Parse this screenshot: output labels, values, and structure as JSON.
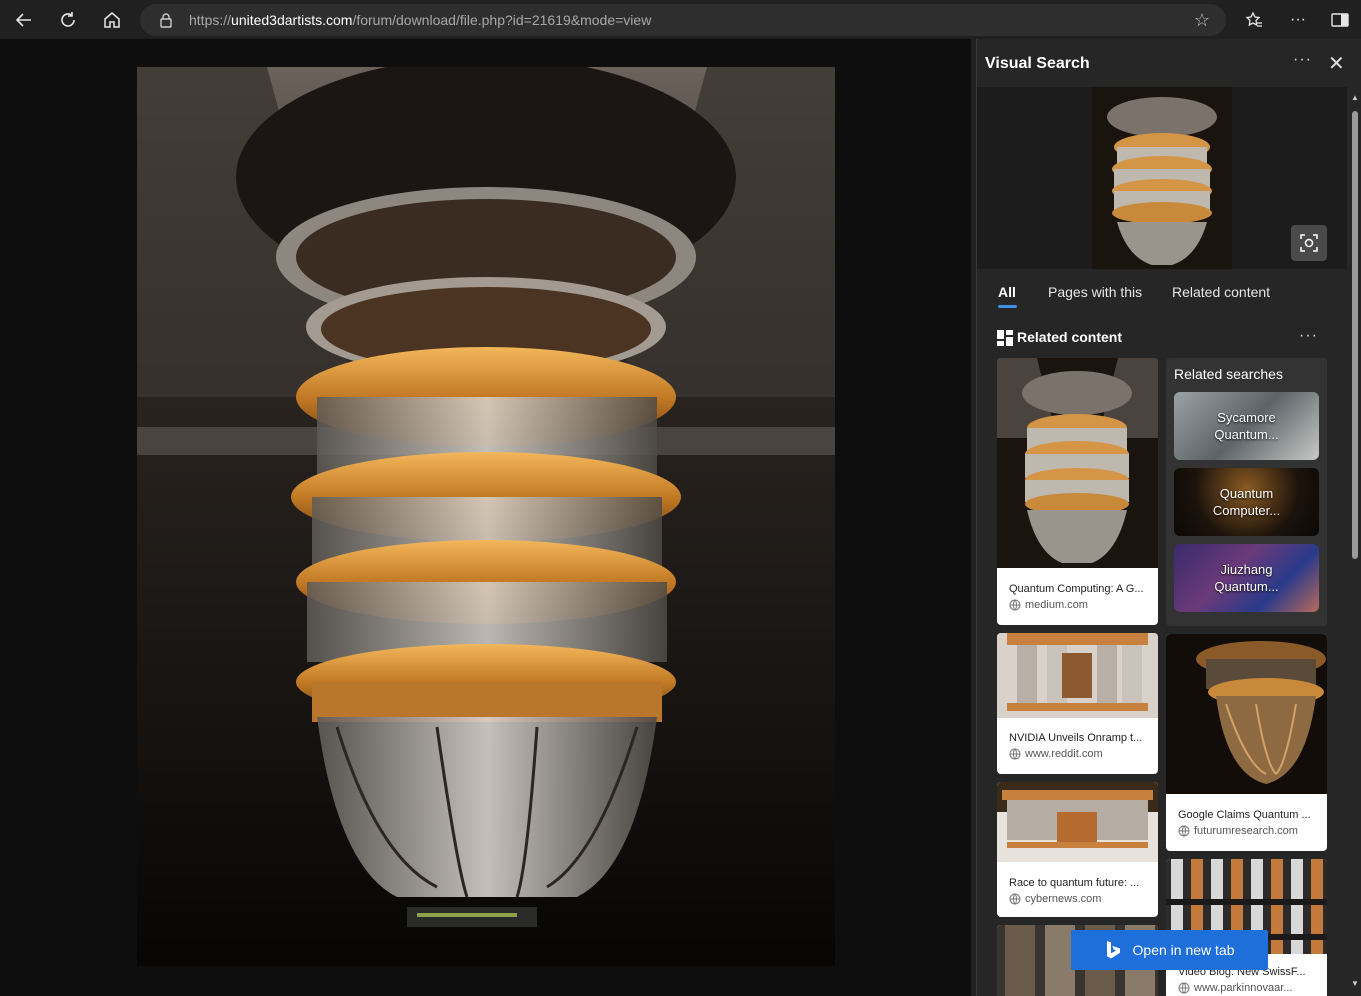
{
  "browser": {
    "url_prefix": "https://",
    "url_domain": "united3dartists.com",
    "url_path": "/forum/download/file.php?id=21619&mode=view"
  },
  "panel": {
    "title": "Visual Search",
    "tabs": [
      "All",
      "Pages with this",
      "Related content"
    ],
    "section_title": "Related content",
    "open_button": "Open in new tab"
  },
  "related_searches": {
    "title": "Related searches",
    "items": [
      "Sycamore Quantum...",
      "Quantum Computer...",
      "Jiuzhang Quantum..."
    ]
  },
  "cards": [
    {
      "caption": "Quantum Computing: A G...",
      "source": "medium.com"
    },
    {
      "caption": "NVIDIA Unveils Onramp t...",
      "source": "www.reddit.com"
    },
    {
      "caption": "Google Claims Quantum ...",
      "source": "futurumresearch.com"
    },
    {
      "caption": "Race to quantum future: ...",
      "source": "cybernews.com"
    },
    {
      "caption": "Video Blog: New SwissF...",
      "source": "www.parkinnovaar..."
    }
  ],
  "colors": {
    "accent": "#1e6fd9",
    "tab_underline": "#3d8ee6",
    "panel_bg": "#262626"
  }
}
